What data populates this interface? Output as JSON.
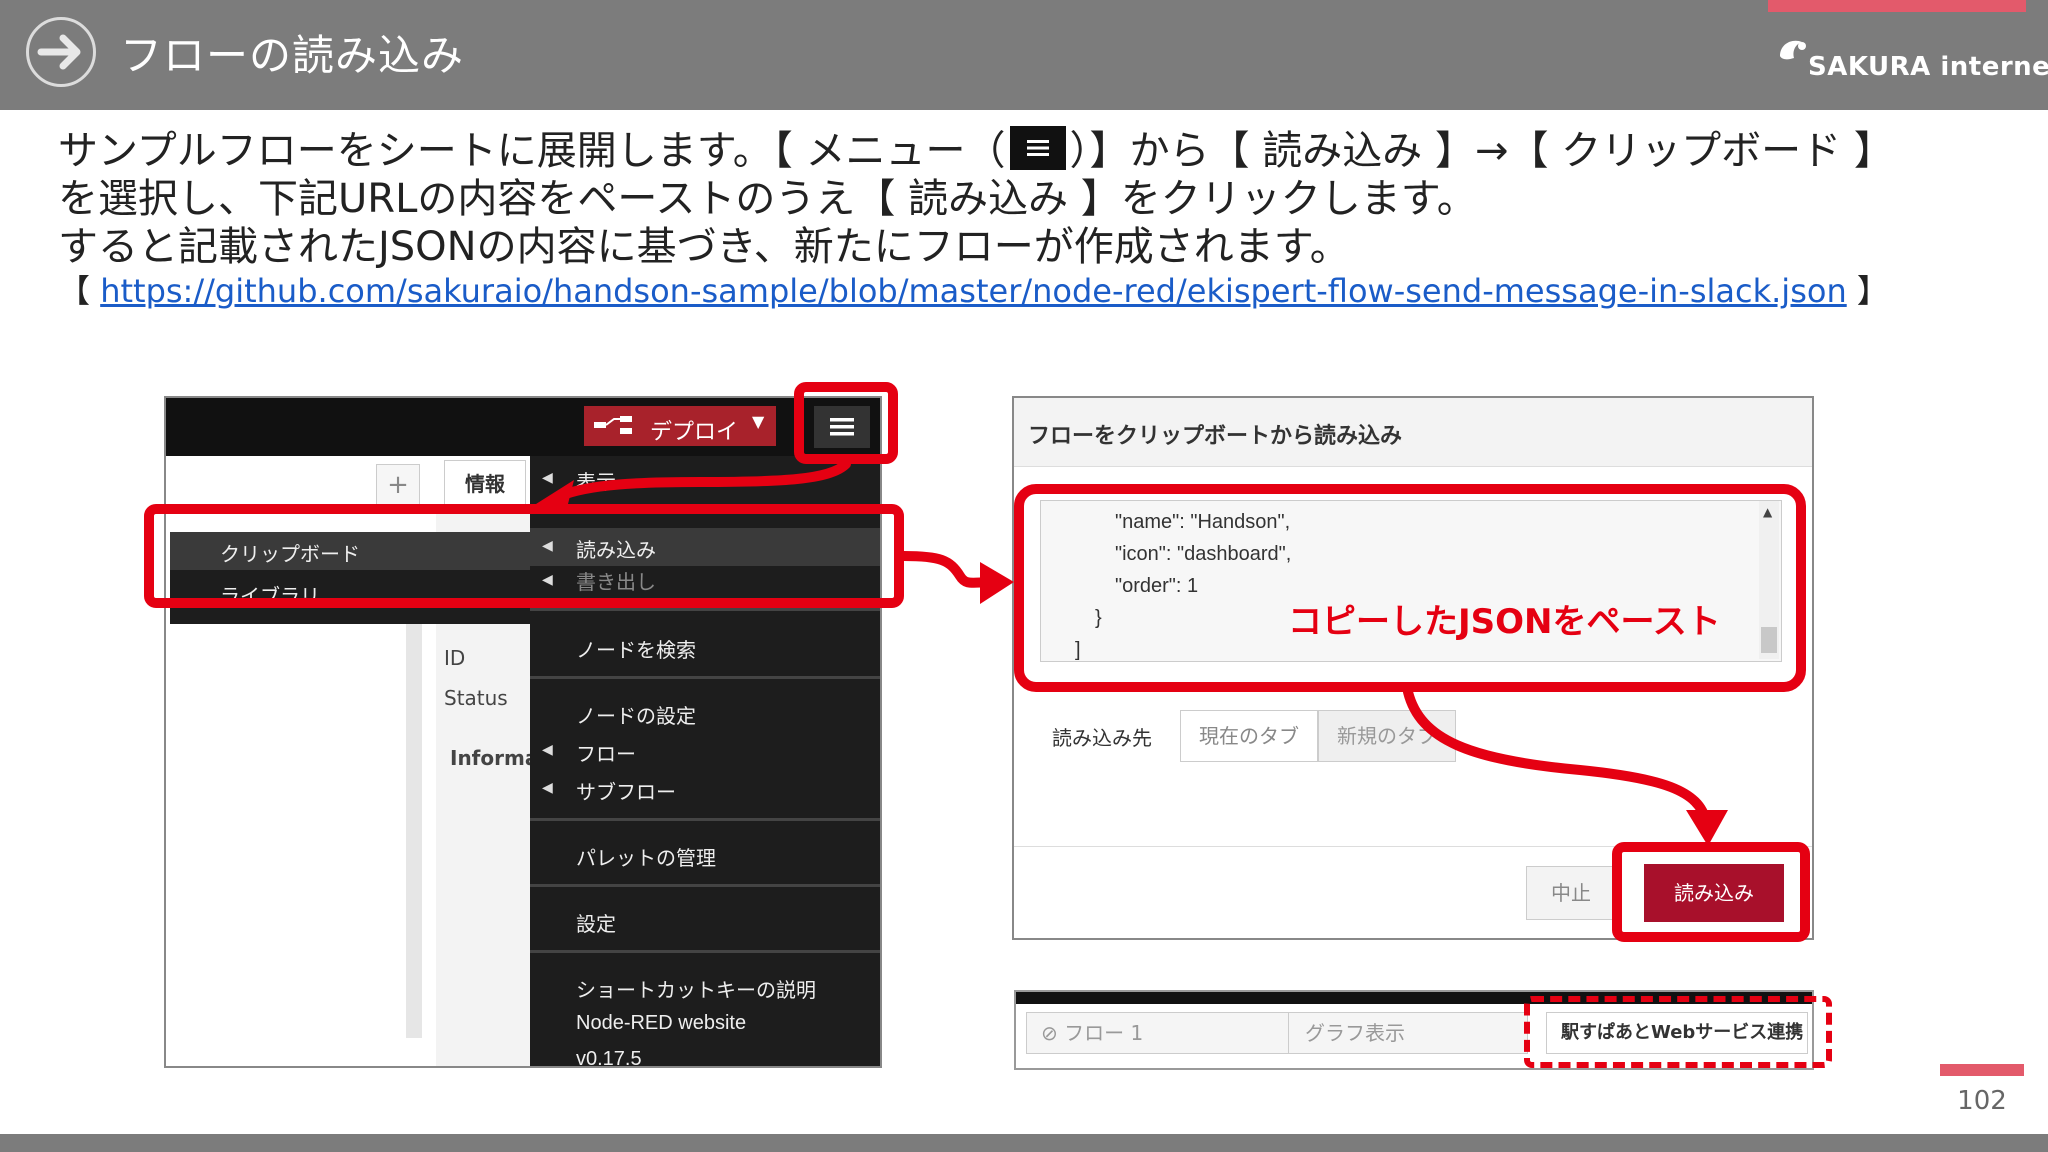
{
  "header": {
    "title": "フローの読み込み",
    "logo_text": "SAKURA internet"
  },
  "body": {
    "line1_a": "サンプルフローをシートに展開します。【 メニュー（",
    "line1_b": "）】から【 読み込み 】→【 クリップボード 】",
    "line2": "を選択し、下記URLの内容をペーストのうえ【 読み込み 】をクリックします。",
    "line3": "すると記載されたJSONの内容に基づき、新たにフローが作成されます。",
    "url_open": "【 ",
    "url": "https://github.com/sakuraio/handson-sample/blob/master/node-red/ekispert-flow-send-message-in-slack.json",
    "url_close": " 】"
  },
  "left_screenshot": {
    "deploy_label": "デプロイ",
    "info_tab": "情報",
    "side_labels": [
      "ID",
      "Status",
      "Informat"
    ],
    "submenu": [
      "クリップボード",
      "ライブラリ"
    ],
    "menu_items": {
      "view": "表示",
      "import": "読み込み",
      "export": "書き出し",
      "search": "ノードを検索",
      "config": "ノードの設定",
      "flows": "フロー",
      "subflows": "サブフロー",
      "palette": "パレットの管理",
      "settings": "設定",
      "shortcuts": "ショートカットキーの説明",
      "website": "Node-RED website",
      "version": "v0.17.5"
    }
  },
  "dialog": {
    "title": "フローをクリップボートから読み込み",
    "code_lines": [
      "\"name\": \"Handson\",",
      "\"icon\": \"dashboard\",",
      "\"order\": 1",
      "}",
      "]"
    ],
    "paste_annotation": "コピーしたJSONをペースト",
    "import_to_label": "読み込み先",
    "tab_current": "現在のタブ",
    "tab_new": "新規のタブ",
    "cancel_label": "中止",
    "import_label": "読み込み"
  },
  "flow_tabs": {
    "tab1": "フロー 1",
    "tab2": "グラフ表示",
    "tab3": "駅すぱあとWebサービス連携"
  },
  "page_number": "102",
  "colors": {
    "highlight_red": "#e50012",
    "header_gray": "#7c7c7c",
    "accent_pink": "#e35a6b",
    "import_button": "#a8102b"
  }
}
